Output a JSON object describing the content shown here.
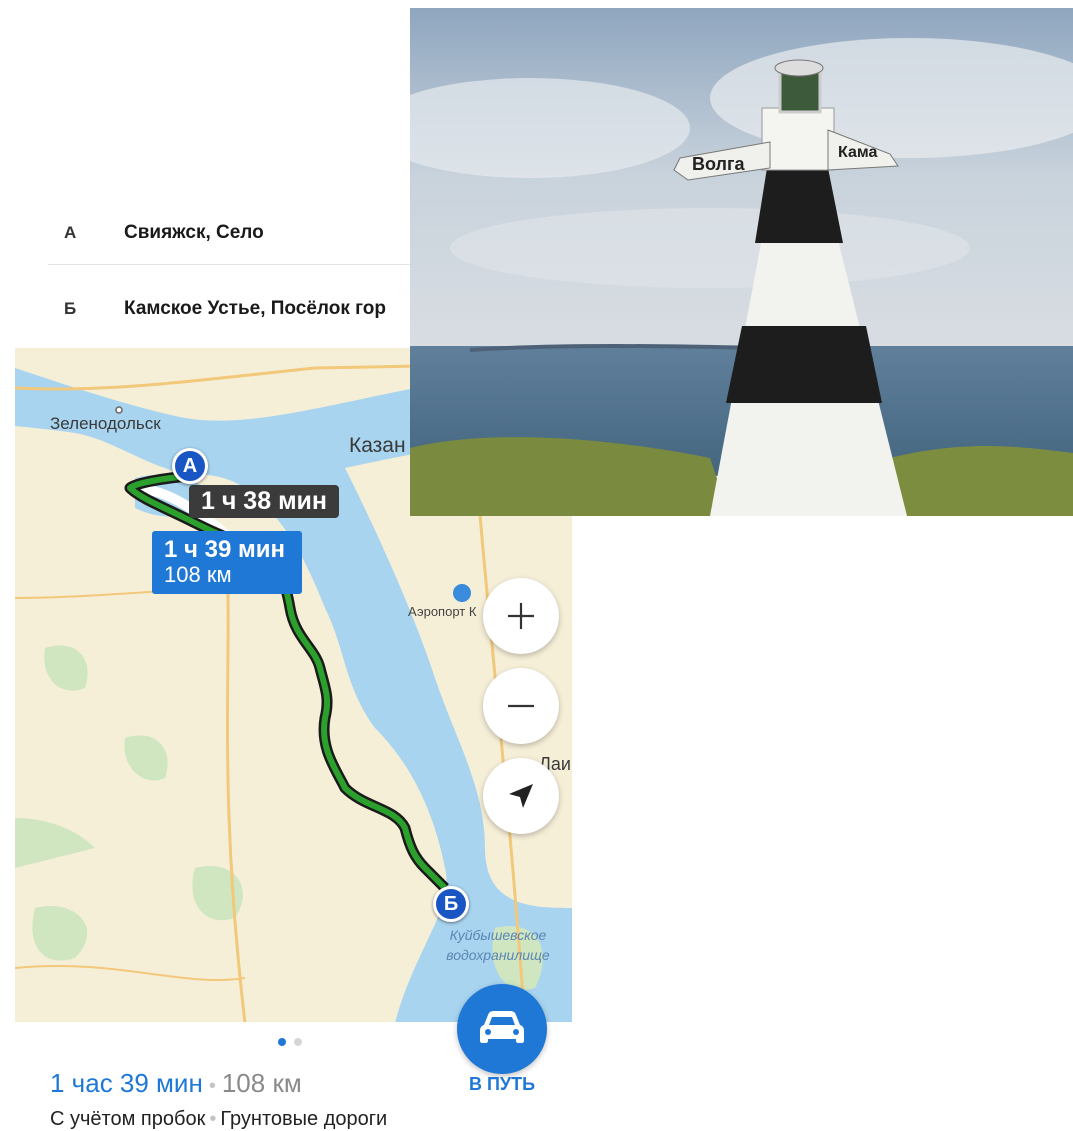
{
  "route": {
    "points": [
      {
        "letter": "А",
        "place": "Свияжск, Село"
      },
      {
        "letter": "Б",
        "place": "Камское Устье, Посёлок гор"
      }
    ]
  },
  "map": {
    "labels": {
      "zelenodolsk": "Зеленодольск",
      "kazan": "Казан",
      "airport": "Аэропорт К",
      "laish": "Лаиш",
      "reservoir_line1": "Куйбышевское",
      "reservoir_line2": "водохранилище"
    },
    "alt_route_time": "1 ч 38 мин",
    "main_route_time": "1 ч 39 мин",
    "main_route_distance": "108 км",
    "pin_a": "А",
    "pin_b": "Б",
    "zoom_in_icon": "plus-icon",
    "zoom_out_icon": "minus-icon",
    "locate_icon": "navigation-arrow-icon"
  },
  "bottom": {
    "time": "1 час 39 мин",
    "separator": "•",
    "distance": "108 км",
    "detail_1": "С учётом пробок",
    "detail_2": "Грунтовые дороги",
    "go_label": "В ПУТЬ",
    "go_icon": "car-icon",
    "page_count": 2,
    "page_active": 1
  },
  "photo": {
    "sign_left": "Волга",
    "sign_right": "Кама"
  },
  "colors": {
    "accent": "#1f78d6",
    "route": "#2ca02c",
    "water": "#a8d4ef",
    "land": "#f6efd8"
  }
}
